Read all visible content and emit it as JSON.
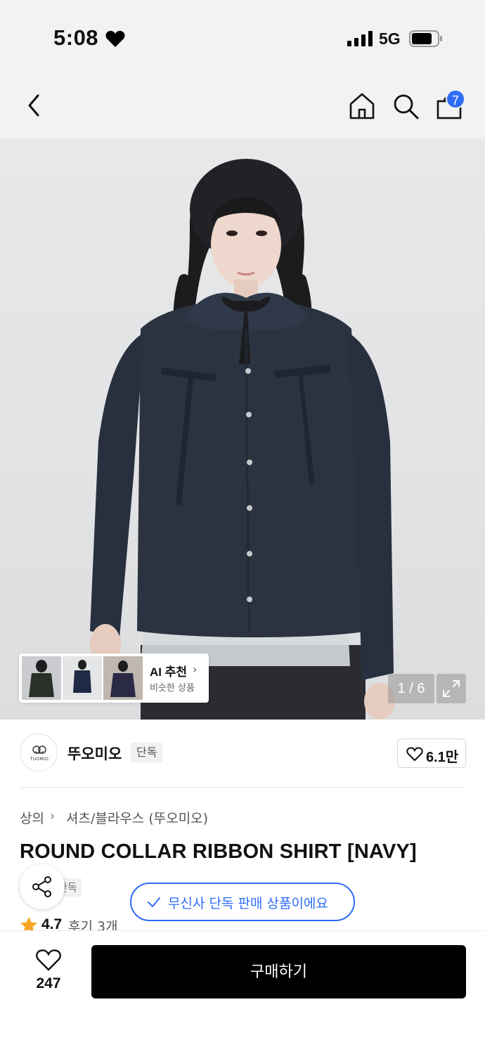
{
  "status_bar": {
    "time": "5:08",
    "network": "5G",
    "icons": [
      "heart-icon",
      "signal-icon",
      "battery-icon"
    ]
  },
  "nav": {
    "icons": [
      "back-icon",
      "home-icon",
      "search-icon",
      "shopping-bag-icon"
    ],
    "cart_count": "7"
  },
  "gallery": {
    "counter": "1 / 6",
    "ai_recommend": {
      "title": "AI 추천",
      "subtitle": "비슷한 상품"
    }
  },
  "brand": {
    "logo_text": "TUOMIO",
    "name": "뚜오미오",
    "tag": "단독",
    "likes": "6.1만"
  },
  "breadcrumb": {
    "category": "상의",
    "subcategory": "셔츠/블라우스 (뚜오미오)"
  },
  "product": {
    "title": "ROUND COLLAR RIBBON SHIRT [NAVY]",
    "tag_partial": "단독",
    "rating": "4.7",
    "reviews": "후기 3개"
  },
  "toast": {
    "text": "무신사 단독 판매 상품이에요"
  },
  "bottom": {
    "like_count": "247",
    "buy_label": "구매하기"
  },
  "colors": {
    "accent_blue": "#2e6cf6",
    "star": "#f5a623",
    "shirt_navy": "#2b3340"
  }
}
